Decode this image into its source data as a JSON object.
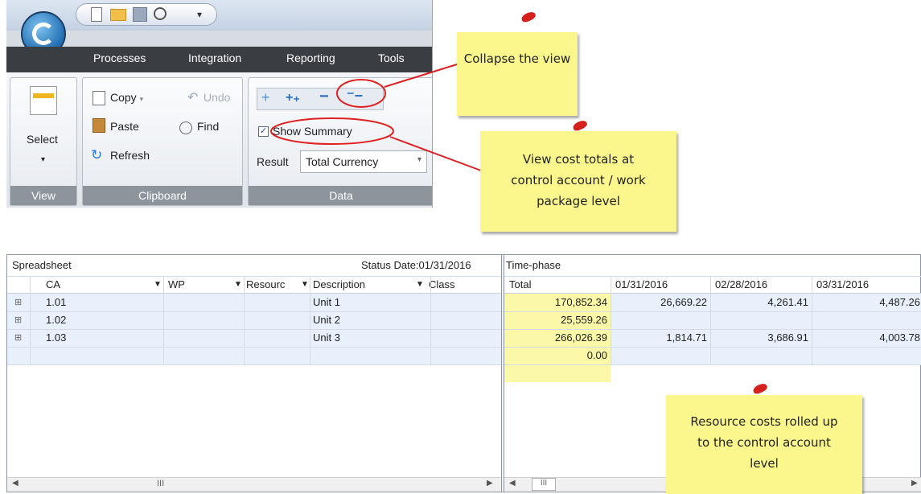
{
  "ribbon": {
    "tabs": [
      "Processes",
      "Integration",
      "Reporting",
      "Tools"
    ],
    "select_label": "Select",
    "clipboard": {
      "copy": "Copy",
      "undo": "Undo",
      "paste": "Paste",
      "find": "Find",
      "refresh": "Refresh"
    },
    "data": {
      "show_summary": "Show Summary",
      "result_label": "Result",
      "result_value": "Total Currency"
    },
    "groups": {
      "view": "View",
      "clipboard": "Clipboard",
      "data": "Data"
    }
  },
  "notes": {
    "collapse": "Collapse the view",
    "summary": "View cost totals at control account / work package level",
    "rollup": "Resource costs rolled up to the control account level"
  },
  "spreadsheet": {
    "title": "Spreadsheet",
    "status": "Status Date:01/31/2016",
    "columns": [
      "CA",
      "WP",
      "Resourc",
      "Description",
      "Class"
    ],
    "rows": [
      {
        "ca": "1.01",
        "desc": "Unit 1"
      },
      {
        "ca": "1.02",
        "desc": "Unit 2"
      },
      {
        "ca": "1.03",
        "desc": "Unit 3"
      }
    ],
    "scroll_mark": "III"
  },
  "timephase": {
    "title": "Time-phase",
    "columns": [
      "Total",
      "01/31/2016",
      "02/28/2016",
      "03/31/2016"
    ],
    "rows": [
      [
        "170,852.34",
        "26,669.22",
        "4,261.41",
        "4,487.26"
      ],
      [
        "25,559.26",
        "",
        "",
        ""
      ],
      [
        "266,026.39",
        "1,814.71",
        "3,686.91",
        "4,003.78"
      ],
      [
        "0.00",
        "",
        "",
        ""
      ]
    ]
  },
  "colors": {
    "accent": "#e02020",
    "note": "#fbf78c",
    "total_cell": "#fbf9a8",
    "row_bg": "#e8f1fb"
  }
}
